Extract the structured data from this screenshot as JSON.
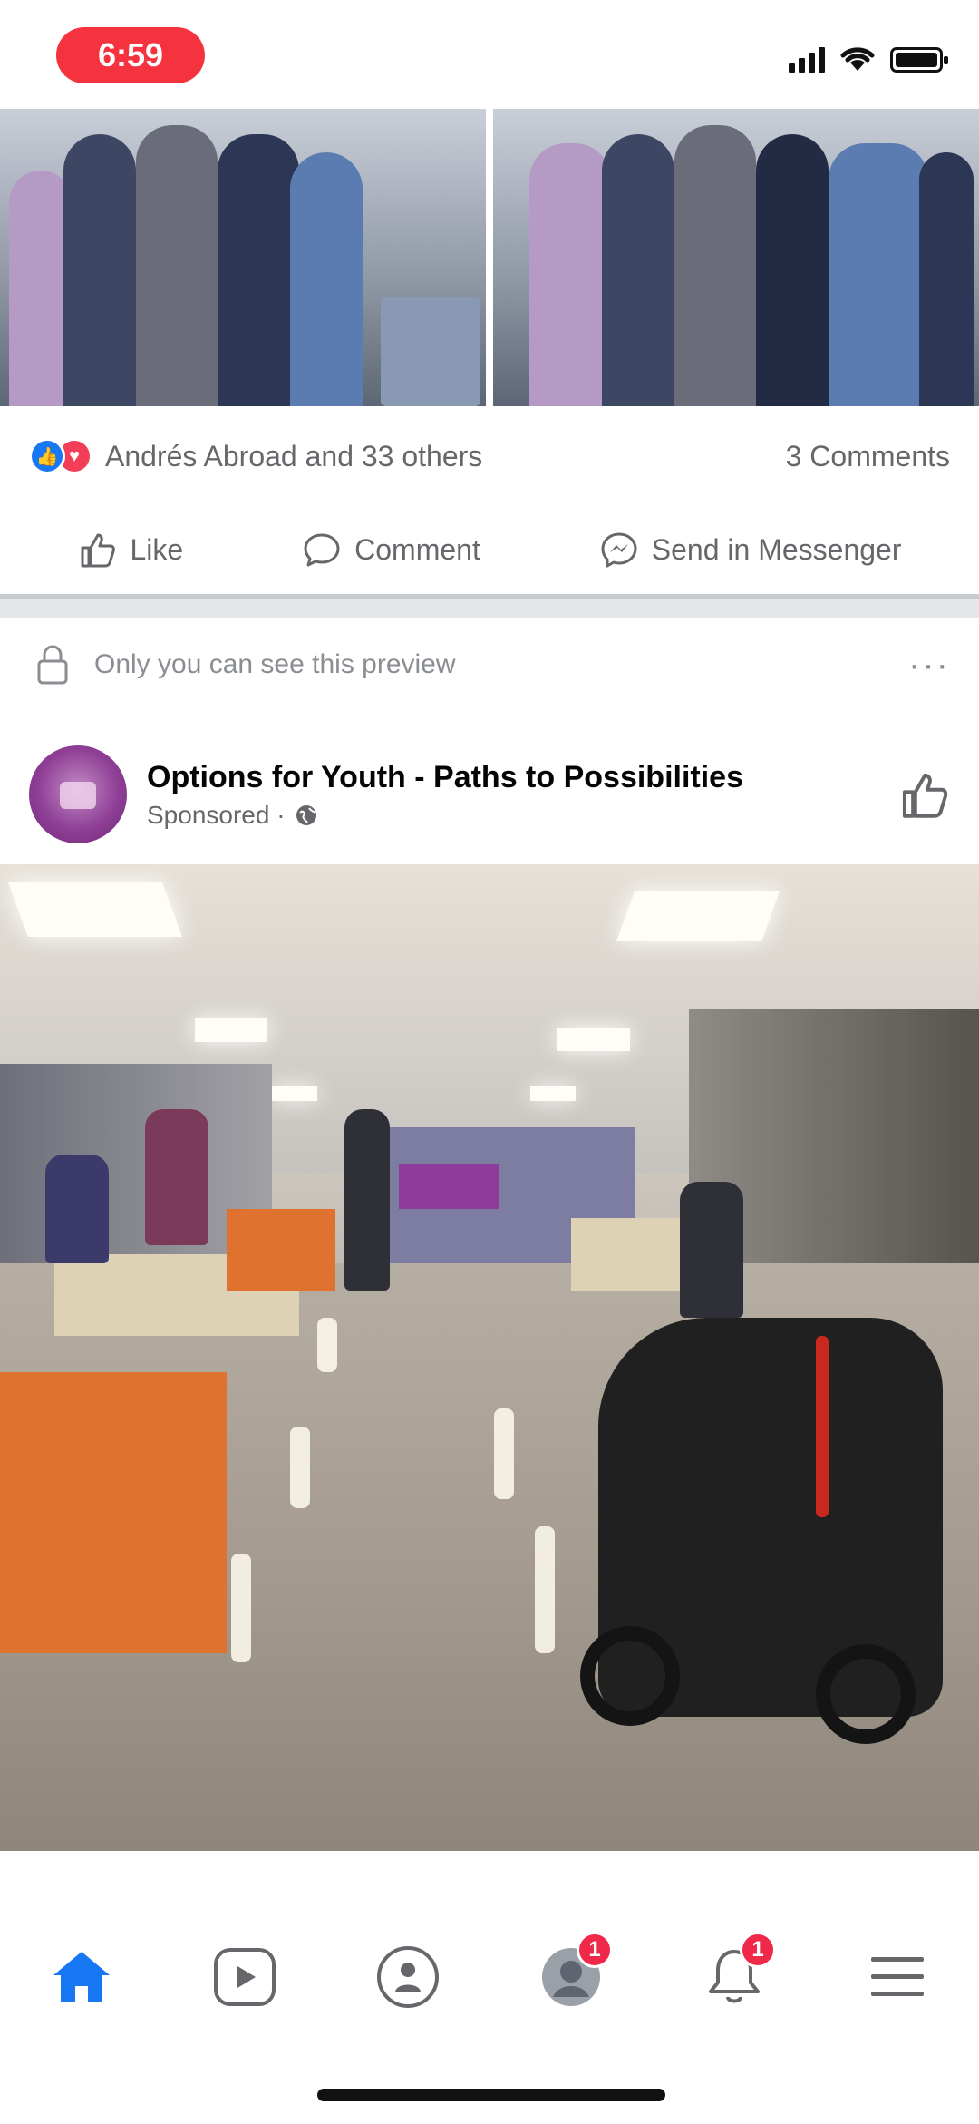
{
  "status_bar": {
    "time": "6:59"
  },
  "post_previous": {
    "reactions_text": "Andrés Abroad and 33 others",
    "comments_text": "3 Comments",
    "actions": {
      "like": "Like",
      "comment": "Comment",
      "send": "Send in Messenger"
    }
  },
  "preview_notice": {
    "text": "Only you can see this preview",
    "more": "···"
  },
  "sponsored_post": {
    "page_name": "Options for Youth - Paths to Possibilities",
    "sponsored_label": "Sponsored · "
  },
  "bottom_nav": {
    "items": [
      {
        "name": "home",
        "active": true
      },
      {
        "name": "watch",
        "active": false
      },
      {
        "name": "groups",
        "active": false
      },
      {
        "name": "profile",
        "active": false,
        "badge": "1"
      },
      {
        "name": "notifications",
        "active": false,
        "badge": "1"
      },
      {
        "name": "menu",
        "active": false
      }
    ]
  },
  "colors": {
    "accent": "#1877f2",
    "badge": "#f02849",
    "time_pill": "#f5333f"
  }
}
